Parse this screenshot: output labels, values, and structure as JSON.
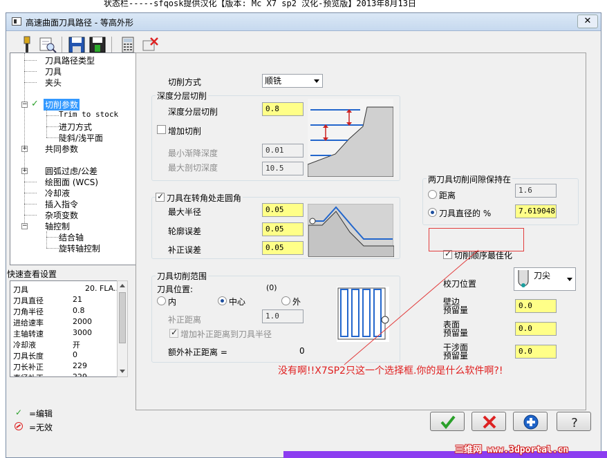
{
  "statusbar": {
    "text": "状态栏-----sfqosk提供汉化【版本: Mc X7 sp2 汉化-预览版】2013年8月13日"
  },
  "window": {
    "title": "高速曲面刀具路径 - 等高外形",
    "close_label": "✕"
  },
  "toolbar": {
    "icons": [
      "tool-icon",
      "preview-icon",
      "save-icon",
      "save-as-icon",
      "calculator-icon",
      "delete-icon"
    ]
  },
  "tree": {
    "items": [
      {
        "label": "刀具路径类型"
      },
      {
        "label": "刀具"
      },
      {
        "label": "夹头"
      },
      {
        "label": "切削参数"
      },
      {
        "label": "Trim to stock"
      },
      {
        "label": "进刀方式"
      },
      {
        "label": "陡斜/浅平面"
      },
      {
        "label": "共同参数"
      },
      {
        "label": "圆弧过虑/公差"
      },
      {
        "label": "绘图面 (WCS)"
      },
      {
        "label": "冷却液"
      },
      {
        "label": "插入指令"
      },
      {
        "label": "杂项变数"
      },
      {
        "label": "轴控制"
      },
      {
        "label": "结合轴"
      },
      {
        "label": "旋转轴控制"
      }
    ]
  },
  "quick_view": {
    "title": "快速查看设置",
    "rows": [
      {
        "key": "刀具",
        "value": "20. FLA.."
      },
      {
        "key": "刀具直径",
        "value": "21"
      },
      {
        "key": "刀角半径",
        "value": "0.8"
      },
      {
        "key": "进给速率",
        "value": "2000"
      },
      {
        "key": "主轴转速",
        "value": "3000"
      },
      {
        "key": "冷却液",
        "value": "开"
      },
      {
        "key": "刀具长度",
        "value": "0"
      },
      {
        "key": "刀长补正",
        "value": "229"
      },
      {
        "key": "直径补正",
        "value": "229"
      }
    ]
  },
  "legend": {
    "edit": "=编辑",
    "invalid": "=无效"
  },
  "cut_params": {
    "cut_method_label": "切削方式",
    "cut_method_value": "顺铣",
    "depth_group": {
      "title": "深度分层切削",
      "depth_label": "深度分层切削",
      "depth_value": "0.8",
      "add_cut_label": "增加切削",
      "min_step_label": "最小渐降深度",
      "min_step_value": "0.01",
      "max_cut_label": "最大剖切深度",
      "max_cut_value": "10.5"
    },
    "corner_group": {
      "title": "刀具在转角处走圆角",
      "max_radius_label": "最大半径",
      "max_radius_value": "0.05",
      "profile_tol_label": "轮廓误差",
      "profile_tol_value": "0.05",
      "offset_tol_label": "补正误差",
      "offset_tol_value": "0.05"
    },
    "range_group": {
      "title": "刀具切削范围",
      "tool_pos_label": "刀具位置:",
      "tool_pos_value": "(0)",
      "inner_label": "内",
      "center_label": "中心",
      "outer_label": "外",
      "offset_dist_label": "补正距离",
      "offset_dist_value": "1.0",
      "add_offset_label": "增加补正距离到刀具半径",
      "extra_offset_label": "额外补正距离 =",
      "extra_offset_value": "0"
    },
    "gap_group": {
      "title": "两刀具切削间隙保持在",
      "distance_label": "距离",
      "distance_value": "1.6",
      "tool_dia_label": "刀具直径的 %",
      "tool_dia_value": "7.619048"
    },
    "optimize_label": "切削顺序最佳化",
    "tip_pos_label": "校刀位置",
    "tip_pos_value": "刀尖",
    "wall_stock_label_1": "壁边",
    "wall_stock_label_2": "预留量",
    "wall_stock_value": "0.0",
    "floor_stock_label_1": "表面",
    "floor_stock_label_2": "预留量",
    "floor_stock_value": "0.0",
    "interf_stock_label_1": "干涉面",
    "interf_stock_label_2": "预留量",
    "interf_stock_value": "0.0"
  },
  "annotation": {
    "text": "没有啊!!X7SP2只这一个选择框.你的是什么软件啊?!"
  },
  "watermark": {
    "text": "三维网 www.3dportal.cn"
  },
  "colors": {
    "field_yellow": "#ffff88",
    "annotation_red": "#e02020",
    "accent_blue": "#1c4e9e"
  }
}
